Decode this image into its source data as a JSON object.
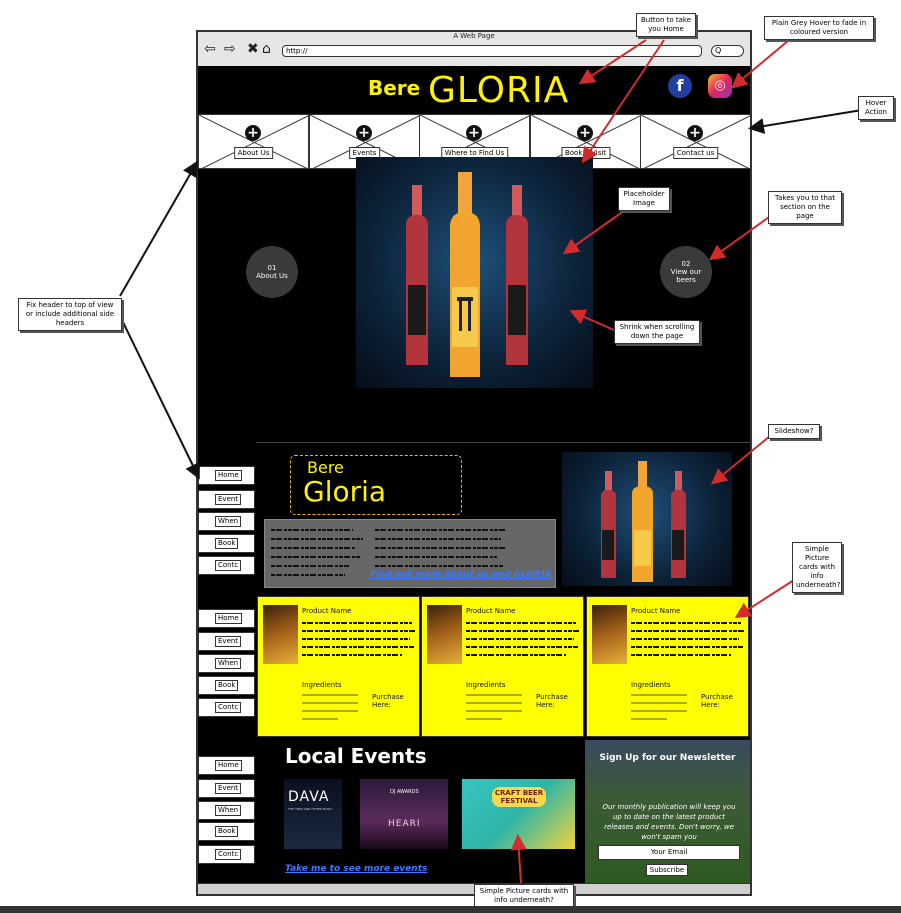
{
  "window": {
    "title": "A Web Page",
    "url": "http://",
    "search_glyph": "Q"
  },
  "header": {
    "logo_small": "Bere",
    "logo_big": "GLORIA",
    "facebook_glyph": "f",
    "instagram_glyph": "◎"
  },
  "nav": {
    "items": [
      "About Us",
      "Events",
      "Where to Find Us",
      "Book a Visit",
      "Contact us"
    ]
  },
  "hero": {
    "left_circle": {
      "number": "01",
      "label": "About Us"
    },
    "right_circle": {
      "number": "02",
      "label": "View our beers"
    }
  },
  "side_nav": {
    "items": [
      "Home",
      "Event",
      "When",
      "Book",
      "Contc"
    ]
  },
  "about": {
    "title_small": "Bere",
    "title_big": "Gloria",
    "link": "Find out more about us and GLORIA"
  },
  "products": [
    {
      "name": "Product Name",
      "ingredients_label": "Ingredients",
      "purchase_label": "Purchase Here:"
    },
    {
      "name": "Product Name",
      "ingredients_label": "Ingredients",
      "purchase_label": "Purchase Here:"
    },
    {
      "name": "Product Name",
      "ingredients_label": "Ingredients",
      "purchase_label": "Purchase Here:"
    }
  ],
  "events": {
    "title": "Local Events",
    "link": "Take me to see more events",
    "card1": {
      "title": "DAVA",
      "subtitle": "THE VIEW AND OTHER MUSIC"
    },
    "card2": {
      "title": "DJ AWARDS",
      "subtitle": "HEARI"
    },
    "card3": {
      "title": "CRAFT BEER FESTIVAL"
    }
  },
  "newsletter": {
    "title": "Sign Up for our Newsletter",
    "body": "Our monthly publication will keep you up to date on the latest product releases and events. Don't worry, we won't spam you",
    "input_placeholder": "Your Email",
    "button": "Subscribe"
  },
  "annotations": {
    "home_button": "Button to take you Home",
    "hover_fade": "Plain Grey Hover to fade in coloured version",
    "hover_action": "Hover Action",
    "placeholder_image": "Placeholder Image",
    "section_link": "Takes you to that section on the page",
    "shrink": "Shrink when scrolling down the page",
    "fix_header": "Fix header to top of view or include additional side headers",
    "slideshow": "Slideshow?",
    "cards_info": "Simple Picture cards with info underneath?",
    "events_cards": "Simple Picture cards with info underneath?"
  },
  "colors": {
    "accent_yellow": "#ffff00",
    "logo_yellow": "#fff200",
    "link_blue": "#3b79ff",
    "annotation_red": "#d22b2b"
  }
}
